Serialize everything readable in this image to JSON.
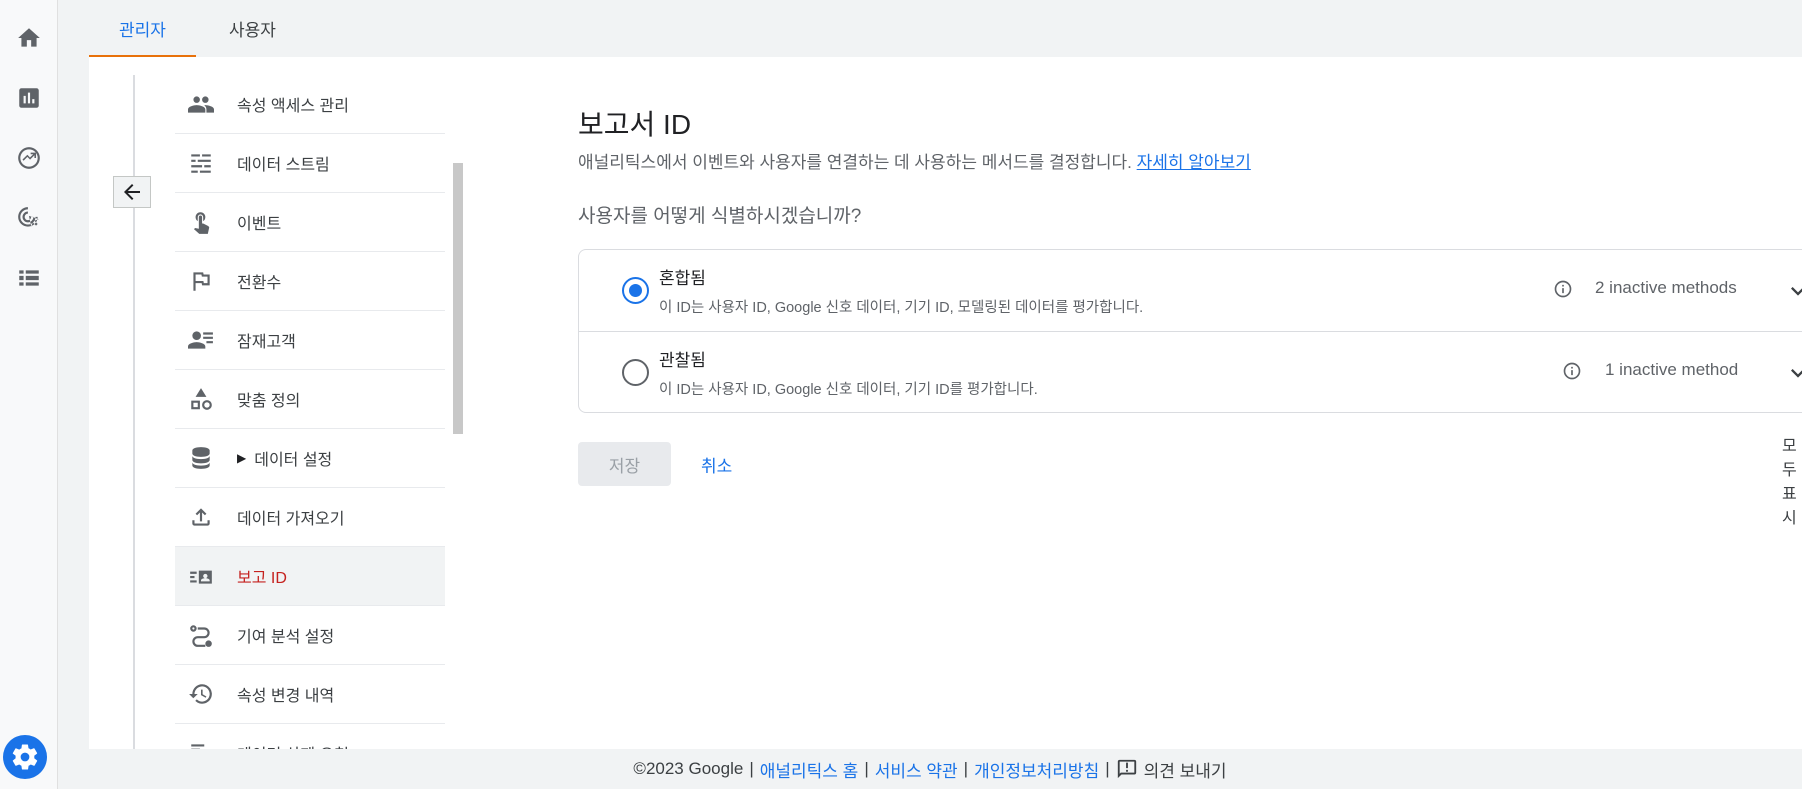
{
  "tabs": [
    {
      "label": "관리자",
      "active": true
    },
    {
      "label": "사용자",
      "active": false
    }
  ],
  "rail": {
    "items": [
      "home-icon",
      "reports-icon",
      "explore-icon",
      "advertising-icon",
      "list-icon"
    ],
    "settings_icon": "gear-icon"
  },
  "nav": {
    "items": [
      {
        "label": "속성 액세스 관리",
        "icon": "people-icon"
      },
      {
        "label": "데이터 스트림",
        "icon": "stream-icon"
      },
      {
        "label": "이벤트",
        "icon": "touch-icon"
      },
      {
        "label": "전환수",
        "icon": "flag-icon"
      },
      {
        "label": "잠재고객",
        "icon": "audience-icon"
      },
      {
        "label": "맞춤 정의",
        "icon": "shapes-icon"
      },
      {
        "label": "데이터 설정",
        "icon": "database-icon",
        "expandable": true
      },
      {
        "label": "데이터 가져오기",
        "icon": "upload-icon"
      },
      {
        "label": "보고 ID",
        "icon": "reporting-id-icon",
        "active": true
      },
      {
        "label": "기여 분석 설정",
        "icon": "route-icon"
      },
      {
        "label": "속성 변경 내역",
        "icon": "history-icon"
      },
      {
        "label": "데이터 삭제 요청",
        "icon": "delete-data-icon"
      }
    ]
  },
  "page": {
    "title": "보고서 ID",
    "description": "애널리틱스에서 이벤트와 사용자를 연결하는 데 사용하는 메서드를 결정합니다.",
    "learn_more": "자세히 알아보기",
    "question": "사용자를 어떻게 식별하시겠습니까?",
    "options": [
      {
        "title": "혼합됨",
        "subtitle": "이 ID는 사용자 ID, Google 신호 데이터, 기기 ID, 모델링된 데이터를 평가합니다.",
        "methods": "2 inactive methods",
        "selected": true
      },
      {
        "title": "관찰됨",
        "subtitle": "이 ID는 사용자 ID, Google 신호 데이터, 기기 ID를 평가합니다.",
        "methods": "1 inactive method",
        "selected": false
      }
    ],
    "show_all": "모두 표시",
    "save": "저장",
    "cancel": "취소"
  },
  "footer": {
    "copyright": "©2023 Google",
    "links": [
      "애널리틱스 홈",
      "서비스 약관",
      "개인정보처리방침"
    ],
    "feedback": "의견 보내기"
  },
  "colors": {
    "accent": "#1a73e8",
    "active_nav": "#c5221f",
    "tab_underline": "#e8710a"
  }
}
